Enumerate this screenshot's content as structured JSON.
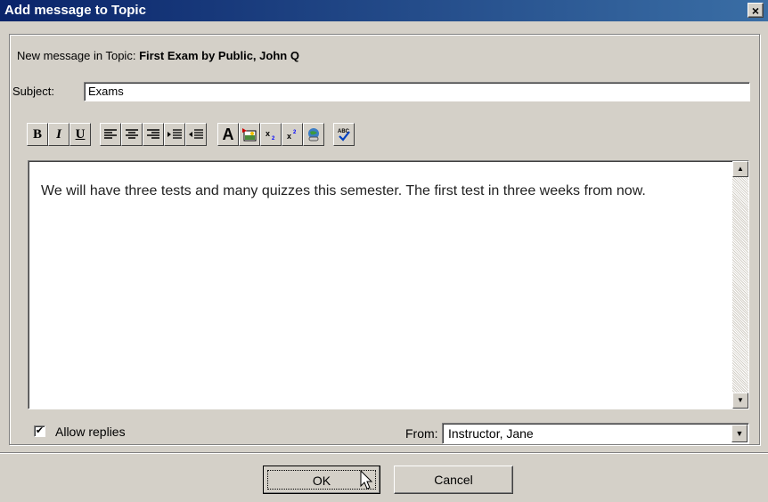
{
  "window": {
    "title": "Add message to Topic",
    "close_glyph": "✕"
  },
  "header": {
    "new_message_prefix": "New message in Topic:",
    "topic_name": "First Exam by Public, John Q"
  },
  "subject": {
    "label": "Subject:",
    "value": "Exams"
  },
  "toolbar": {
    "bold": "B",
    "italic": "I",
    "underline": "U",
    "font_color": "A",
    "icons": [
      "bold-icon",
      "italic-icon",
      "underline-icon",
      "align-left-icon",
      "align-center-icon",
      "align-right-icon",
      "indent-icon",
      "outdent-icon",
      "font-color-icon",
      "insert-image-icon",
      "subscript-icon",
      "superscript-icon",
      "insert-link-icon",
      "spellcheck-icon"
    ]
  },
  "editor": {
    "body": "We will have three tests and many quizzes this semester.  The first test in three weeks from now."
  },
  "options": {
    "allow_replies_label": "Allow replies",
    "allow_replies_checked": true
  },
  "from": {
    "label": "From:",
    "value": "Instructor, Jane"
  },
  "buttons": {
    "ok": "OK",
    "cancel": "Cancel"
  },
  "colors": {
    "title_start": "#0a246a",
    "title_end": "#3a6ea5",
    "face": "#d4d0c8"
  }
}
